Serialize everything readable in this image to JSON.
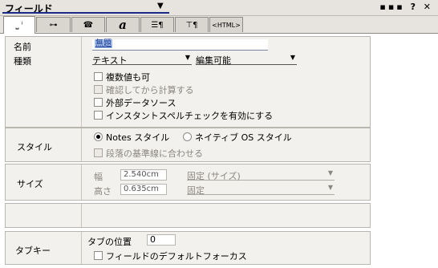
{
  "title": "フィールド",
  "window_controls": "▪▪▪ ? ✕",
  "tabs": [
    {
      "name": "tab-basics",
      "glyph": "⎵ ⁱ"
    },
    {
      "name": "tab-control",
      "glyph": "⊶"
    },
    {
      "name": "tab-advanced",
      "glyph": "☎"
    },
    {
      "name": "tab-font",
      "glyph": "a"
    },
    {
      "name": "tab-paragraph",
      "glyph": "☰¶"
    },
    {
      "name": "tab-hidewhen",
      "glyph": "⊤¶"
    },
    {
      "name": "tab-html",
      "glyph": "<HTML>"
    }
  ],
  "basics": {
    "name_label": "名前",
    "name_value": "無題",
    "type_label": "種類",
    "type_value": "テキスト",
    "mode_value": "編集可能",
    "options": [
      {
        "label": "複数値も可",
        "enabled": true
      },
      {
        "label": "確認してから計算する",
        "enabled": false
      },
      {
        "label": "外部データソース",
        "enabled": true
      },
      {
        "label": "インスタントスペルチェックを有効にする",
        "enabled": true
      }
    ]
  },
  "style": {
    "label": "スタイル",
    "notes_style": "Notes スタイル",
    "native_style": "ネイティブ OS スタイル",
    "baseline": "段落の基準線に合わせる"
  },
  "size": {
    "label": "サイズ",
    "width_label": "幅",
    "width_value": "2.540cm",
    "width_mode": "固定 (サイズ)",
    "height_label": "高さ",
    "height_value": "0.635cm",
    "height_mode": "固定"
  },
  "tabkey": {
    "label": "タブキー",
    "tab_position_label": "タブの位置",
    "tab_position_value": "0",
    "default_focus": "フィールドのデフォルトフォーカス"
  }
}
